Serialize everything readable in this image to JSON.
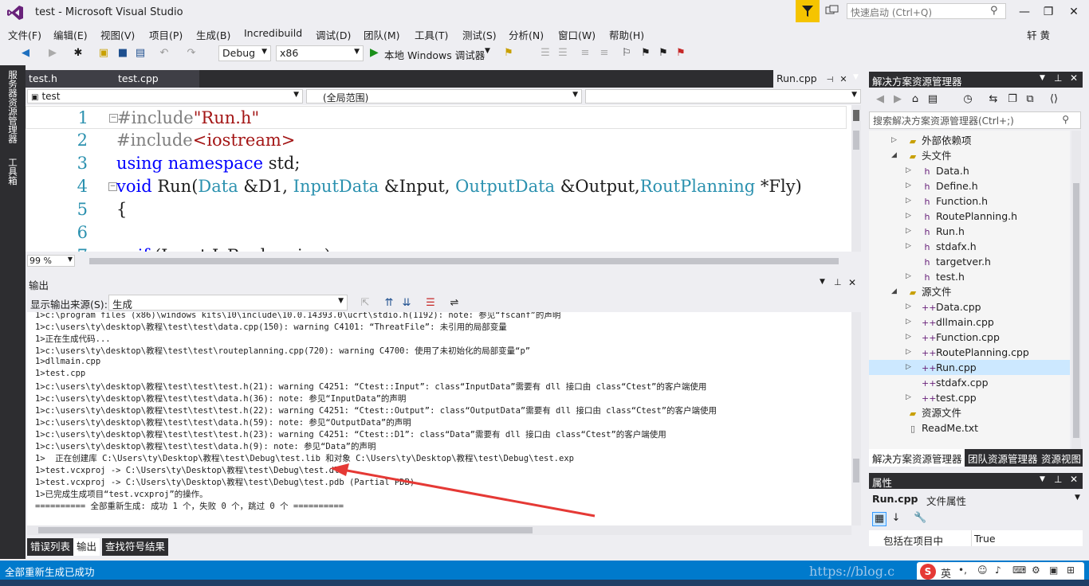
{
  "window": {
    "title": "test - Microsoft Visual Studio",
    "quick_launch_placeholder": "快速启动 (Ctrl+Q)",
    "user": "轩 黄"
  },
  "menu": [
    "文件(F)",
    "编辑(E)",
    "视图(V)",
    "项目(P)",
    "生成(B)",
    "Incredibuild",
    "调试(D)",
    "团队(M)",
    "工具(T)",
    "测试(S)",
    "分析(N)",
    "窗口(W)",
    "帮助(H)"
  ],
  "toolbar": {
    "config": "Debug",
    "platform": "x86",
    "run_label": "本地 Windows 调试器"
  },
  "left_strip": {
    "tab1": "服务器资源管理器",
    "tab2": "工具箱"
  },
  "editor": {
    "tabs": {
      "t1": "test.h",
      "t2": "test.cpp",
      "active": "Run.cpp"
    },
    "nav": {
      "project": "test",
      "scope": "(全局范围)",
      "member": ""
    },
    "line_numbers": [
      "1",
      "2",
      "3",
      "4",
      "5",
      "6",
      "7"
    ],
    "zoom": "99 %"
  },
  "output": {
    "title": "输出",
    "source_label": "显示输出来源(S):",
    "source_value": "生成",
    "lines": [
      "1>c:\\program files (x86)\\windows kits\\10\\include\\10.0.14393.0\\ucrt\\stdio.h(1192): note: 参见“fscanf”的声明",
      "1>c:\\users\\ty\\desktop\\教程\\test\\test\\data.cpp(150): warning C4101: “ThreatFile”: 未引用的局部变量",
      "1>正在生成代码...",
      "1>c:\\users\\ty\\desktop\\教程\\test\\test\\routeplanning.cpp(720): warning C4700: 使用了未初始化的局部变量“p”",
      "1>dllmain.cpp",
      "1>test.cpp",
      "1>c:\\users\\ty\\desktop\\教程\\test\\test\\test.h(21): warning C4251: “Ctest::Input”: class“InputData”需要有 dll 接口由 class“Ctest”的客户端使用",
      "1>c:\\users\\ty\\desktop\\教程\\test\\test\\data.h(36): note: 参见“InputData”的声明",
      "1>c:\\users\\ty\\desktop\\教程\\test\\test\\test.h(22): warning C4251: “Ctest::Output”: class“OutputData”需要有 dll 接口由 class“Ctest”的客户端使用",
      "1>c:\\users\\ty\\desktop\\教程\\test\\test\\data.h(59): note: 参见“OutputData”的声明",
      "1>c:\\users\\ty\\desktop\\教程\\test\\test\\test.h(23): warning C4251: “Ctest::D1”: class“Data”需要有 dll 接口由 class“Ctest”的客户端使用",
      "1>c:\\users\\ty\\desktop\\教程\\test\\test\\data.h(9): note: 参见“Data”的声明",
      "1>  正在创建库 C:\\Users\\ty\\Desktop\\教程\\test\\Debug\\test.lib 和对象 C:\\Users\\ty\\Desktop\\教程\\test\\Debug\\test.exp",
      "1>test.vcxproj -> C:\\Users\\ty\\Desktop\\教程\\test\\Debug\\test.dll",
      "1>test.vcxproj -> C:\\Users\\ty\\Desktop\\教程\\test\\Debug\\test.pdb (Partial PDB)",
      "1>已完成生成项目“test.vcxproj”的操作。",
      "========== 全部重新生成: 成功 1 个，失败 0 个，跳过 0 个 =========="
    ],
    "bottom_tabs": {
      "errors": "错误列表",
      "output": "输出",
      "find": "查找符号结果"
    }
  },
  "solution_explorer": {
    "title": "解决方案资源管理器",
    "search_placeholder": "搜索解决方案资源管理器(Ctrl+;)",
    "items": [
      {
        "label": "外部依赖项"
      },
      {
        "label": "头文件"
      },
      {
        "label": "Data.h"
      },
      {
        "label": "Define.h"
      },
      {
        "label": "Function.h"
      },
      {
        "label": "RoutePlanning.h"
      },
      {
        "label": "Run.h"
      },
      {
        "label": "stdafx.h"
      },
      {
        "label": "targetver.h"
      },
      {
        "label": "test.h"
      },
      {
        "label": "源文件"
      },
      {
        "label": "Data.cpp"
      },
      {
        "label": "dllmain.cpp"
      },
      {
        "label": "Function.cpp"
      },
      {
        "label": "RoutePlanning.cpp"
      },
      {
        "label": "Run.cpp"
      },
      {
        "label": "stdafx.cpp"
      },
      {
        "label": "test.cpp"
      },
      {
        "label": "资源文件"
      },
      {
        "label": "ReadMe.txt"
      }
    ],
    "bottom_tabs": {
      "t1": "解决方案资源管理器",
      "t2": "团队资源管理器",
      "t3": "资源视图"
    }
  },
  "properties": {
    "title": "属性",
    "subject": "Run.cpp",
    "subject_desc": "文件属性",
    "row_name": "包括在项目中",
    "row_value": "True"
  },
  "status": {
    "text": "全部重新生成已成功",
    "watermark": "https://blog.c",
    "ime": "英"
  },
  "colors": {
    "accent": "#007acc",
    "dark": "#2d2d30",
    "filter": "#f5c400",
    "arrow": "#e53935"
  }
}
